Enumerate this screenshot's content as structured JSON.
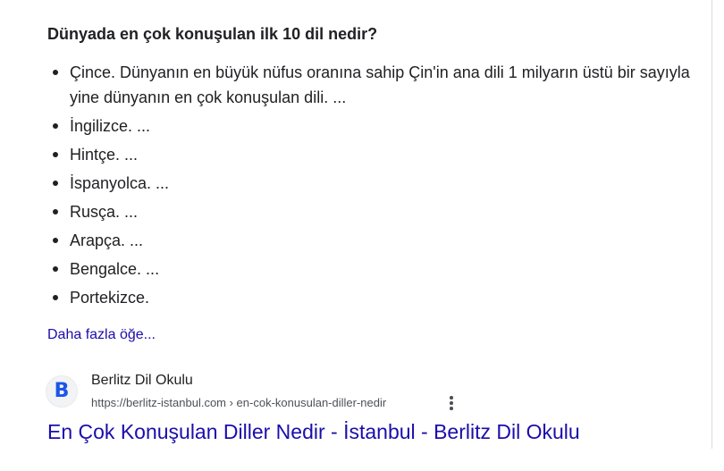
{
  "snippet": {
    "heading": "Dünyada en çok konuşulan ilk 10 dil nedir?",
    "items": [
      "Çince. Dünyanın en büyük nüfus oranına sahip Çin'in ana dili 1 milyarın üstü bir sayıyla yine dünyanın en çok konuşulan dili. ...",
      "İngilizce. ...",
      "Hintçe. ...",
      "İspanyolca. ...",
      "Rusça. ...",
      "Arapça. ...",
      "Bengalce. ...",
      "Portekizce."
    ],
    "more_link": "Daha fazla öğe..."
  },
  "result": {
    "favicon_letter": "B",
    "favicon_icon": "berlitz-logo-icon",
    "site_name": "Berlitz Dil Okulu",
    "url": "https://berlitz-istanbul.com › en-cok-konusulan-diller-nedir",
    "menu_icon": "more-vert-icon",
    "title": "En Çok Konuşulan Diller Nedir - İstanbul - Berlitz Dil Okulu"
  },
  "colors": {
    "link": "#1a0dab",
    "text": "#202124",
    "secondary_text": "#4d5156",
    "favicon_brand": "#1a56e8"
  }
}
